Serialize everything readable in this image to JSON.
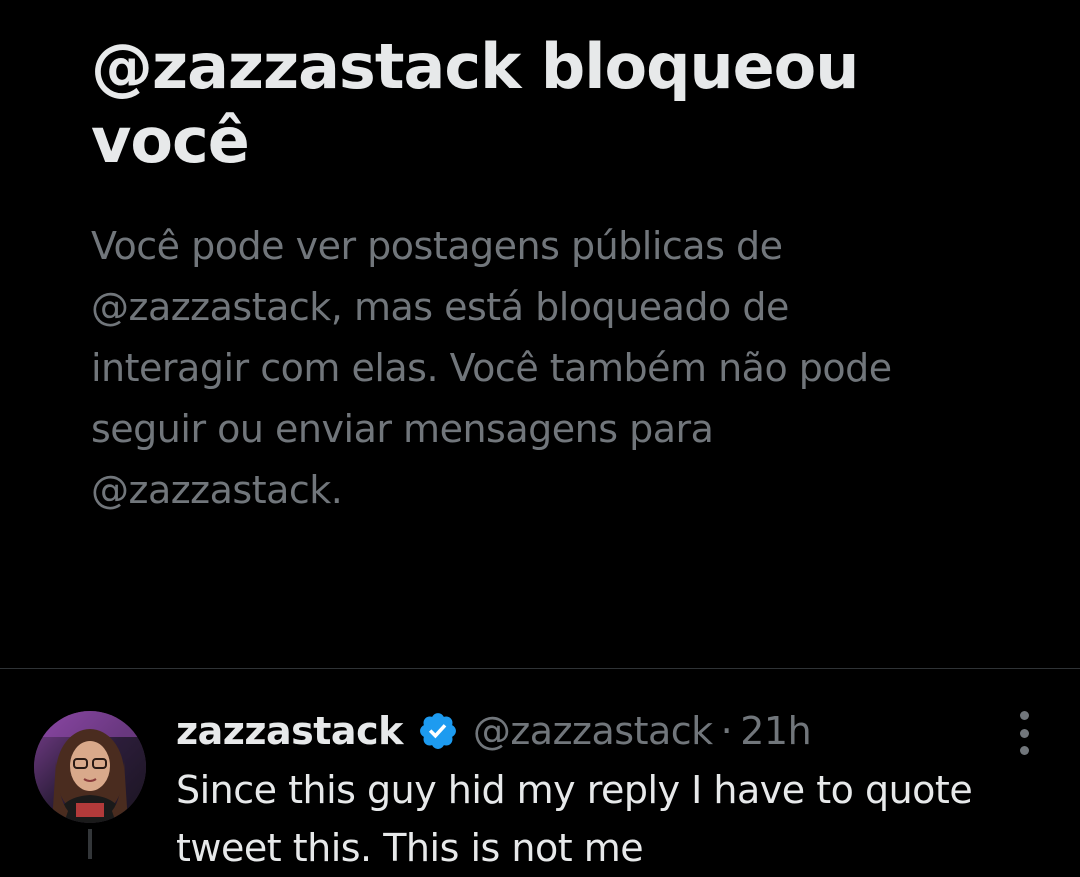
{
  "blocked_notice": {
    "title": "@zazzastack bloqueou você",
    "description": "Você pode ver postagens públicas de @zazzastack, mas está bloqueado de interagir com elas. Você também não pode seguir ou enviar mensagens para @zazzastack."
  },
  "tweet": {
    "display_name": "zazzastack",
    "verified": true,
    "handle": "@zazzastack",
    "separator": "·",
    "time": "21h",
    "text": "Since this guy hid my reply I have to quote tweet this. This is not me",
    "avatar_icon": "user-avatar"
  },
  "colors": {
    "background": "#000000",
    "primary_text": "#e7e9ea",
    "secondary_text": "#71767b",
    "divider": "#2f3336",
    "verified_badge": "#1d9bf0"
  }
}
